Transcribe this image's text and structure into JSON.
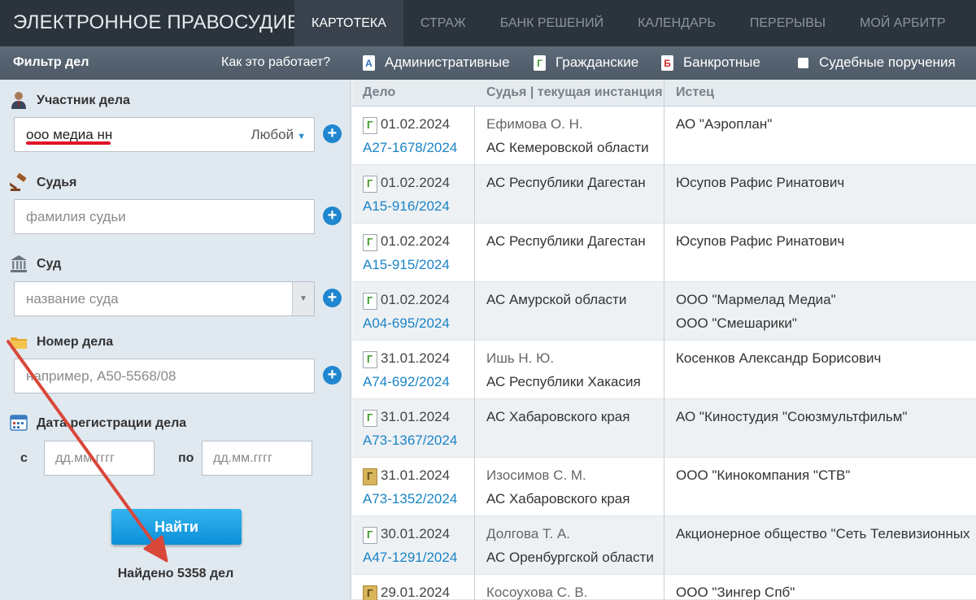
{
  "app": {
    "title": "ЭЛЕКТРОННОЕ ПРАВОСУДИЕ"
  },
  "nav": {
    "items": [
      "КАРТОТЕКА",
      "СТРАЖ",
      "БАНК РЕШЕНИЙ",
      "КАЛЕНДАРЬ",
      "ПЕРЕРЫВЫ",
      "МОЙ АРБИТР"
    ],
    "active": "КАРТОТЕКА"
  },
  "filter": {
    "title": "Фильтр дел",
    "how_it_works": "Как это работает?",
    "participant": {
      "label": "Участник дела",
      "value": "ооо медиа нн",
      "role": "Любой"
    },
    "judge": {
      "label": "Судья",
      "placeholder": "фамилия судьи"
    },
    "court": {
      "label": "Суд",
      "placeholder": "название суда"
    },
    "case_number": {
      "label": "Номер дела",
      "placeholder": "например, А50-5568/08"
    },
    "reg_date": {
      "label": "Дата регистрации дела",
      "from_label": "с",
      "to_label": "по",
      "from_placeholder": "дд.мм.гггг",
      "to_placeholder": "дд.мм.гггг"
    },
    "find_button": "Найти",
    "found_text": "Найдено 5358 дел"
  },
  "categories": {
    "administrative": {
      "icon": "А",
      "label": "Административные"
    },
    "civil": {
      "icon": "Г",
      "label": "Гражданские"
    },
    "bankruptcy": {
      "icon": "Б",
      "label": "Банкротные"
    },
    "court_orders": {
      "label": "Судебные поручения"
    }
  },
  "table": {
    "headers": {
      "case": "Дело",
      "judge": "Судья | текущая инстанция",
      "plaintiff": "Истец"
    },
    "rows": [
      {
        "date": "01.02.2024",
        "number": "А27-1678/2024",
        "judge": "Ефимова О. Н.",
        "court": "АС Кемеровской области",
        "plaintiff": [
          "АО \"Аэроплан\""
        ]
      },
      {
        "date": "01.02.2024",
        "number": "А15-916/2024",
        "judge": "",
        "court": "АС Республики Дагестан",
        "plaintiff": [
          "Юсупов Рафис Ринатович"
        ]
      },
      {
        "date": "01.02.2024",
        "number": "А15-915/2024",
        "judge": "",
        "court": "АС Республики Дагестан",
        "plaintiff": [
          "Юсупов Рафис Ринатович"
        ]
      },
      {
        "date": "01.02.2024",
        "number": "А04-695/2024",
        "judge": "",
        "court": "АС Амурской области",
        "plaintiff": [
          "ООО \"Мармелад Медиа\"",
          "ООО \"Смешарики\""
        ]
      },
      {
        "date": "31.01.2024",
        "number": "А74-692/2024",
        "judge": "Ишь Н. Ю.",
        "court": "АС Республики Хакасия",
        "plaintiff": [
          "Косенков Александр Борисович"
        ]
      },
      {
        "date": "31.01.2024",
        "number": "А73-1367/2024",
        "judge": "",
        "court": "АС Хабаровского края",
        "plaintiff": [
          "АО \"Киностудия \"Союзмультфильм\""
        ]
      },
      {
        "date": "31.01.2024",
        "number": "А73-1352/2024",
        "judge": "Изосимов С. М.",
        "court": "АС Хабаровского края",
        "plaintiff": [
          "ООО \"Кинокомпания \"СТВ\""
        ]
      },
      {
        "date": "30.01.2024",
        "number": "А47-1291/2024",
        "judge": "Долгова Т. А.",
        "court": "АС Оренбургской области",
        "plaintiff": [
          "Акционерное общество \"Сеть Телевизионных"
        ]
      },
      {
        "date": "29.01.2024",
        "number": "",
        "judge": "Косоухова С. В.",
        "court": "",
        "plaintiff": [
          "ООО \"Зингер Спб\""
        ]
      }
    ]
  },
  "colors": {
    "topbar": "#2b333c",
    "accent": "#1f86cf",
    "annotation": "#e0102a",
    "arrow": "#d9473a"
  }
}
